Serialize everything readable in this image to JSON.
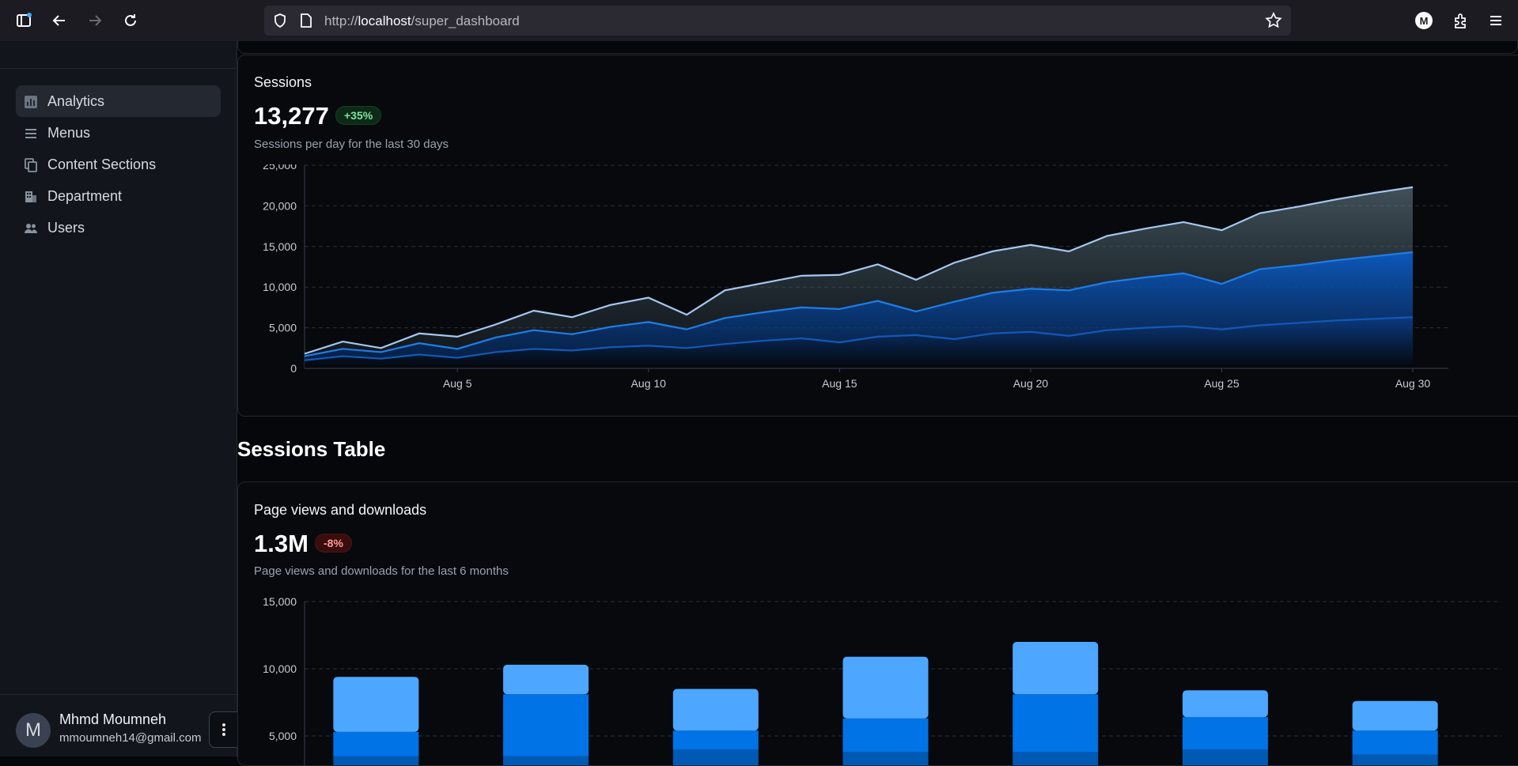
{
  "browser": {
    "url_prefix": "http://",
    "url_host": "localhost",
    "url_path": "/super_dashboard",
    "profile_initial": "M"
  },
  "sidebar": {
    "items": [
      {
        "label": "Analytics",
        "icon": "bar-chart-icon",
        "active": true
      },
      {
        "label": "Menus",
        "icon": "menu-lines-icon",
        "active": false
      },
      {
        "label": "Content Sections",
        "icon": "copy-icon",
        "active": false
      },
      {
        "label": "Department",
        "icon": "building-icon",
        "active": false
      },
      {
        "label": "Users",
        "icon": "people-icon",
        "active": false
      }
    ],
    "user": {
      "avatar_initial": "M",
      "name": "Mhmd Moumneh",
      "email": "mmoumneh14@gmail.com"
    }
  },
  "sessions_card": {
    "title": "Sessions",
    "value": "13,277",
    "badge": "+35%",
    "subtitle": "Sessions per day for the last 30 days"
  },
  "section_heading": "Sessions Table",
  "pageviews_card": {
    "title": "Page views and downloads",
    "value": "1.3M",
    "badge": "-8%",
    "subtitle": "Page views and downloads for the last 6 months"
  },
  "colors": {
    "light_blue": "#a6c8f0",
    "mid_blue": "#1e7ee8",
    "dark_blue": "#1458b8",
    "bar_light": "#4da6ff",
    "bar_mid": "#0073e6",
    "bar_dark": "#0059b3",
    "badge_up_bg": "#0d2a17",
    "badge_down_bg": "#3a0d0d"
  },
  "chart_data": [
    {
      "type": "area",
      "title": "",
      "xlabel": "",
      "ylabel": "",
      "ylim": [
        0,
        25000
      ],
      "y_ticks": [
        "0",
        "5,000",
        "10,000",
        "15,000",
        "20,000",
        "25,000"
      ],
      "x_ticks": [
        "Aug 5",
        "Aug 10",
        "Aug 15",
        "Aug 20",
        "Aug 25",
        "Aug 30"
      ],
      "x_tick_days": [
        5,
        10,
        15,
        20,
        25,
        30
      ],
      "x": [
        1,
        2,
        3,
        4,
        5,
        6,
        7,
        8,
        9,
        10,
        11,
        12,
        13,
        14,
        15,
        16,
        17,
        18,
        19,
        20,
        21,
        22,
        23,
        24,
        25,
        26,
        27,
        28,
        29,
        30
      ],
      "stacked": true,
      "grid": true,
      "series": [
        {
          "values": [
            1000,
            1500,
            1200,
            1700,
            1300,
            2000,
            2400,
            2200,
            2600,
            2800,
            2500,
            3000,
            3400,
            3700,
            3200,
            3900,
            4100,
            3600,
            4300,
            4500,
            4000,
            4700,
            5000,
            5200,
            4800,
            5300,
            5600,
            5900,
            6100,
            6300
          ]
        },
        {
          "values": [
            500,
            900,
            800,
            1400,
            1100,
            1800,
            2300,
            2000,
            2500,
            2900,
            2300,
            3200,
            3500,
            3800,
            4100,
            4400,
            2900,
            4600,
            5000,
            5300,
            5600,
            5900,
            6200,
            6500,
            5600,
            6900,
            7100,
            7400,
            7700,
            8000
          ]
        },
        {
          "values": [
            300,
            900,
            500,
            1200,
            1500,
            1600,
            2400,
            2100,
            2700,
            3000,
            1800,
            3400,
            3600,
            3900,
            4200,
            4500,
            3900,
            4800,
            5100,
            5400,
            4800,
            5700,
            6000,
            6300,
            6600,
            6900,
            7200,
            7500,
            7800,
            8000
          ]
        }
      ]
    },
    {
      "type": "bar",
      "stacked": true,
      "ylim": [
        0,
        15000
      ],
      "y_ticks": [
        "5,000",
        "10,000",
        "15,000"
      ],
      "y_tick_values": [
        5000,
        10000,
        15000
      ],
      "categories": [
        "",
        "",
        "",
        "",
        "",
        "",
        ""
      ],
      "grid": true,
      "series": [
        {
          "values": [
            3500,
            3500,
            4000,
            3800,
            3800,
            4000,
            3600
          ]
        },
        {
          "values": [
            1800,
            4600,
            1400,
            2500,
            4300,
            2400,
            1800
          ]
        },
        {
          "values": [
            4100,
            2200,
            3100,
            4600,
            3900,
            2000,
            2200
          ]
        }
      ]
    }
  ]
}
